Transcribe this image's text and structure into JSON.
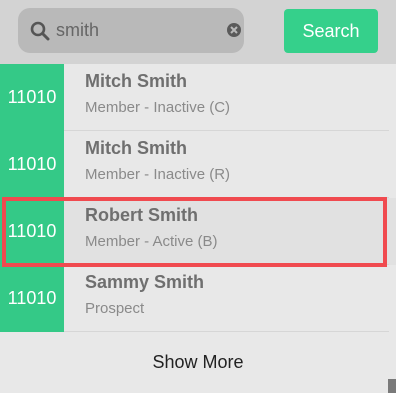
{
  "search": {
    "value": "smith",
    "button_label": "Search"
  },
  "results": [
    {
      "id": "11010",
      "name": "Mitch Smith",
      "status": "Member - Inactive (C)"
    },
    {
      "id": "11010",
      "name": "Mitch Smith",
      "status": "Member - Inactive (R)"
    },
    {
      "id": "11010",
      "name": "Robert Smith",
      "status": "Member - Active (B)",
      "selected": true
    },
    {
      "id": "11010",
      "name": "Sammy Smith",
      "status": "Prospect"
    }
  ],
  "footer": {
    "show_more_label": "Show More"
  },
  "colors": {
    "accent": "#35d08b",
    "badge": "#34c987",
    "highlight": "#f04a4f"
  },
  "icons": {
    "search": "search-icon",
    "clear": "clear-icon"
  }
}
